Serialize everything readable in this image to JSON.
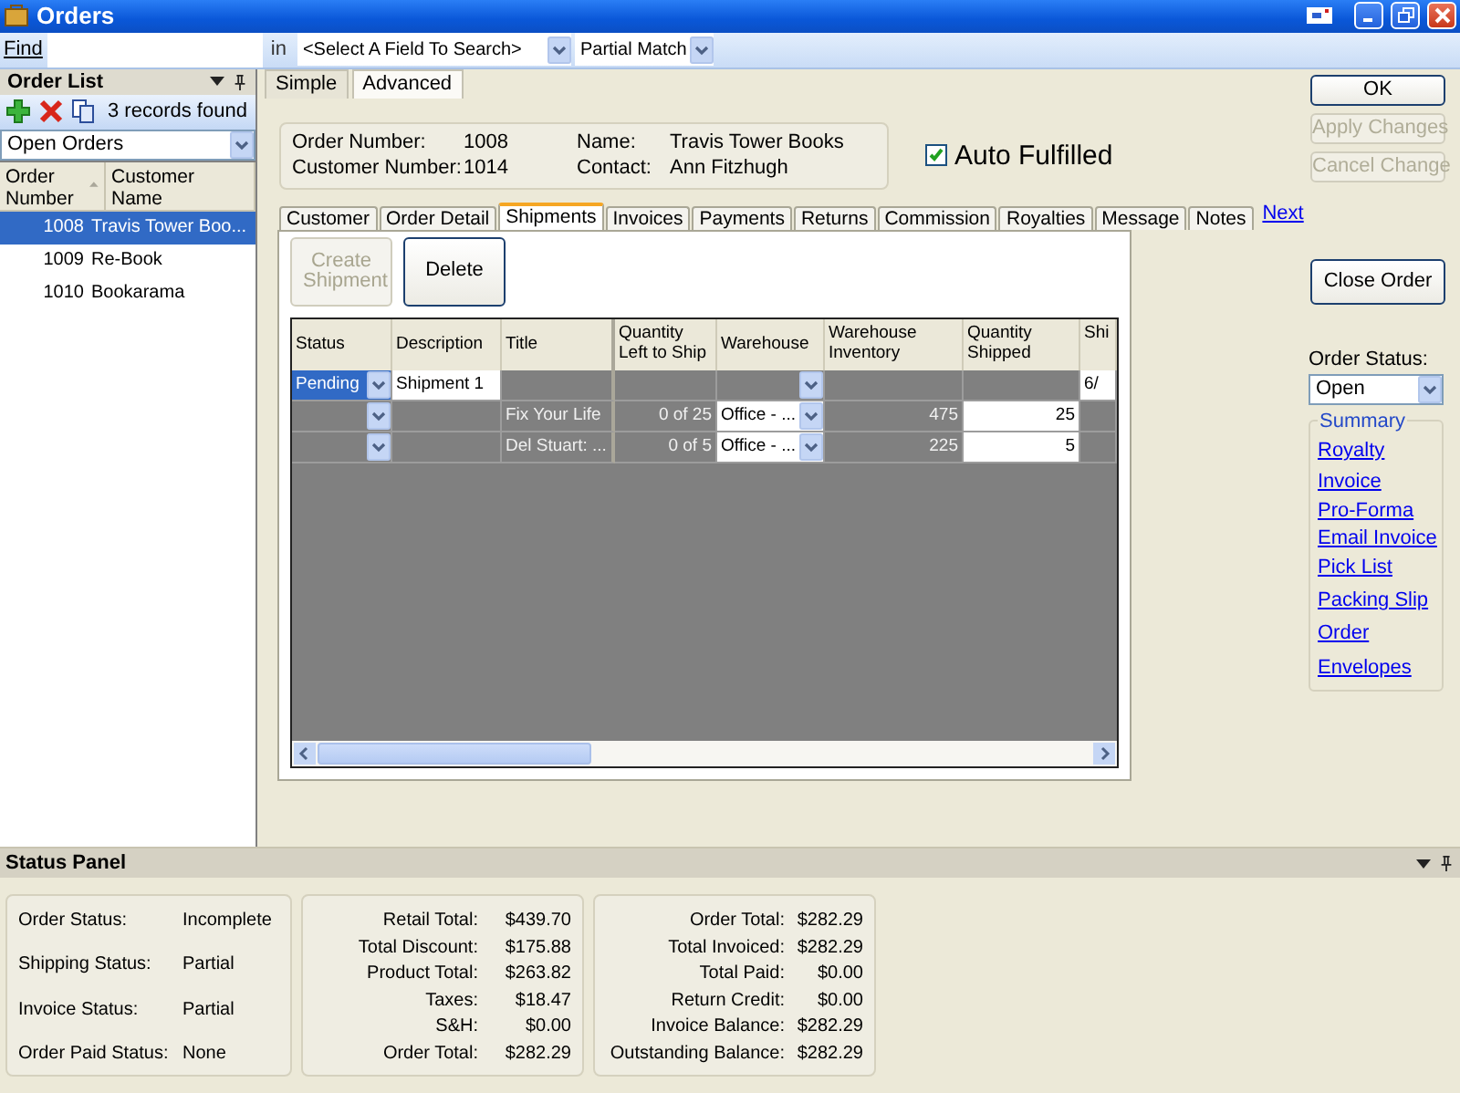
{
  "window": {
    "title": "Orders"
  },
  "find_bar": {
    "label": "Find",
    "in_label": "in",
    "field_select": "<Select A Field To Search>",
    "match_select": "Partial Match"
  },
  "order_list": {
    "title": "Order List",
    "records_found": "3 records found",
    "filter": "Open Orders",
    "columns": [
      "Order Number",
      "Customer Name"
    ],
    "rows": [
      {
        "number": "1008",
        "name": "Travis Tower Boo...",
        "selected": true
      },
      {
        "number": "1009",
        "name": "Re-Book",
        "selected": false
      },
      {
        "number": "1010",
        "name": "Bookarama",
        "selected": false
      }
    ]
  },
  "mode_tabs": [
    {
      "label": "Simple",
      "selected": false
    },
    {
      "label": "Advanced",
      "selected": true
    }
  ],
  "order_header": {
    "order_number_label": "Order Number:",
    "order_number": "1008",
    "customer_number_label": "Customer Number:",
    "customer_number": "1014",
    "name_label": "Name:",
    "name": "Travis Tower Books",
    "contact_label": "Contact:",
    "contact": "Ann Fitzhugh"
  },
  "auto_fulfilled": {
    "label": "Auto Fulfilled",
    "checked": true
  },
  "tabs": [
    {
      "label": "Customer",
      "selected": false
    },
    {
      "label": "Order Detail",
      "selected": false
    },
    {
      "label": "Shipments",
      "selected": true
    },
    {
      "label": "Invoices",
      "selected": false
    },
    {
      "label": "Payments",
      "selected": false
    },
    {
      "label": "Returns",
      "selected": false
    },
    {
      "label": "Commission",
      "selected": false
    },
    {
      "label": "Royalties",
      "selected": false
    },
    {
      "label": "Message",
      "selected": false
    },
    {
      "label": "Notes",
      "selected": false
    }
  ],
  "next_link": "Next",
  "shipment_buttons": [
    {
      "label": "Create Shipment",
      "disabled": true
    },
    {
      "label": "Delete",
      "disabled": false
    }
  ],
  "grid": {
    "columns": [
      "Status",
      "Description",
      "Title",
      "Quantity Left to Ship",
      "Warehouse",
      "Warehouse Inventory",
      "Quantity Shipped",
      "Shi"
    ],
    "rows": [
      {
        "kind": "shipment",
        "selected": true,
        "status": "Pending",
        "description": "Shipment 1",
        "ship_date": "6/"
      },
      {
        "kind": "item",
        "selected": false,
        "title": "Fix Your Life",
        "qty_left": "0 of 25",
        "warehouse": "Office - ...",
        "inventory": "475",
        "qty_shipped": "25"
      },
      {
        "kind": "item",
        "selected": false,
        "title": "Del Stuart: ...",
        "qty_left": "0 of 5",
        "warehouse": "Office - ...",
        "inventory": "225",
        "qty_shipped": "5"
      }
    ]
  },
  "actions": [
    {
      "label": "OK",
      "disabled": false
    },
    {
      "label": "Apply Changes",
      "disabled": true
    },
    {
      "label": "Cancel Change",
      "disabled": true
    }
  ],
  "close_order": "Close Order",
  "order_status": {
    "label": "Order Status:",
    "value": "Open"
  },
  "summary": {
    "title": "Summary",
    "links": [
      "Royalty",
      "Invoice",
      "Pro-Forma",
      "Email Invoice",
      "Pick List",
      "Packing Slip",
      "Order",
      "Envelopes"
    ]
  },
  "status_panel": {
    "title": "Status Panel",
    "statuses": [
      {
        "label": "Order Status:",
        "value": "Incomplete"
      },
      {
        "label": "Shipping Status:",
        "value": "Partial"
      },
      {
        "label": "Invoice Status:",
        "value": "Partial"
      },
      {
        "label": "Order Paid Status:",
        "value": "None"
      }
    ],
    "totals": [
      {
        "label": "Retail Total:",
        "value": "$439.70"
      },
      {
        "label": "Total Discount:",
        "value": "$175.88"
      },
      {
        "label": "Product Total:",
        "value": "$263.82"
      },
      {
        "label": "Taxes:",
        "value": "$18.47"
      },
      {
        "label": "S&H:",
        "value": "$0.00"
      },
      {
        "label": "Order Total:",
        "value": "$282.29"
      }
    ],
    "balances": [
      {
        "label": "Order Total:",
        "value": "$282.29"
      },
      {
        "label": "Total Invoiced:",
        "value": "$282.29"
      },
      {
        "label": "Total Paid:",
        "value": "$0.00"
      },
      {
        "label": "Return Credit:",
        "value": "$0.00"
      },
      {
        "label": "Invoice Balance:",
        "value": "$282.29"
      },
      {
        "label": "Outstanding Balance:",
        "value": "$282.29"
      }
    ]
  }
}
